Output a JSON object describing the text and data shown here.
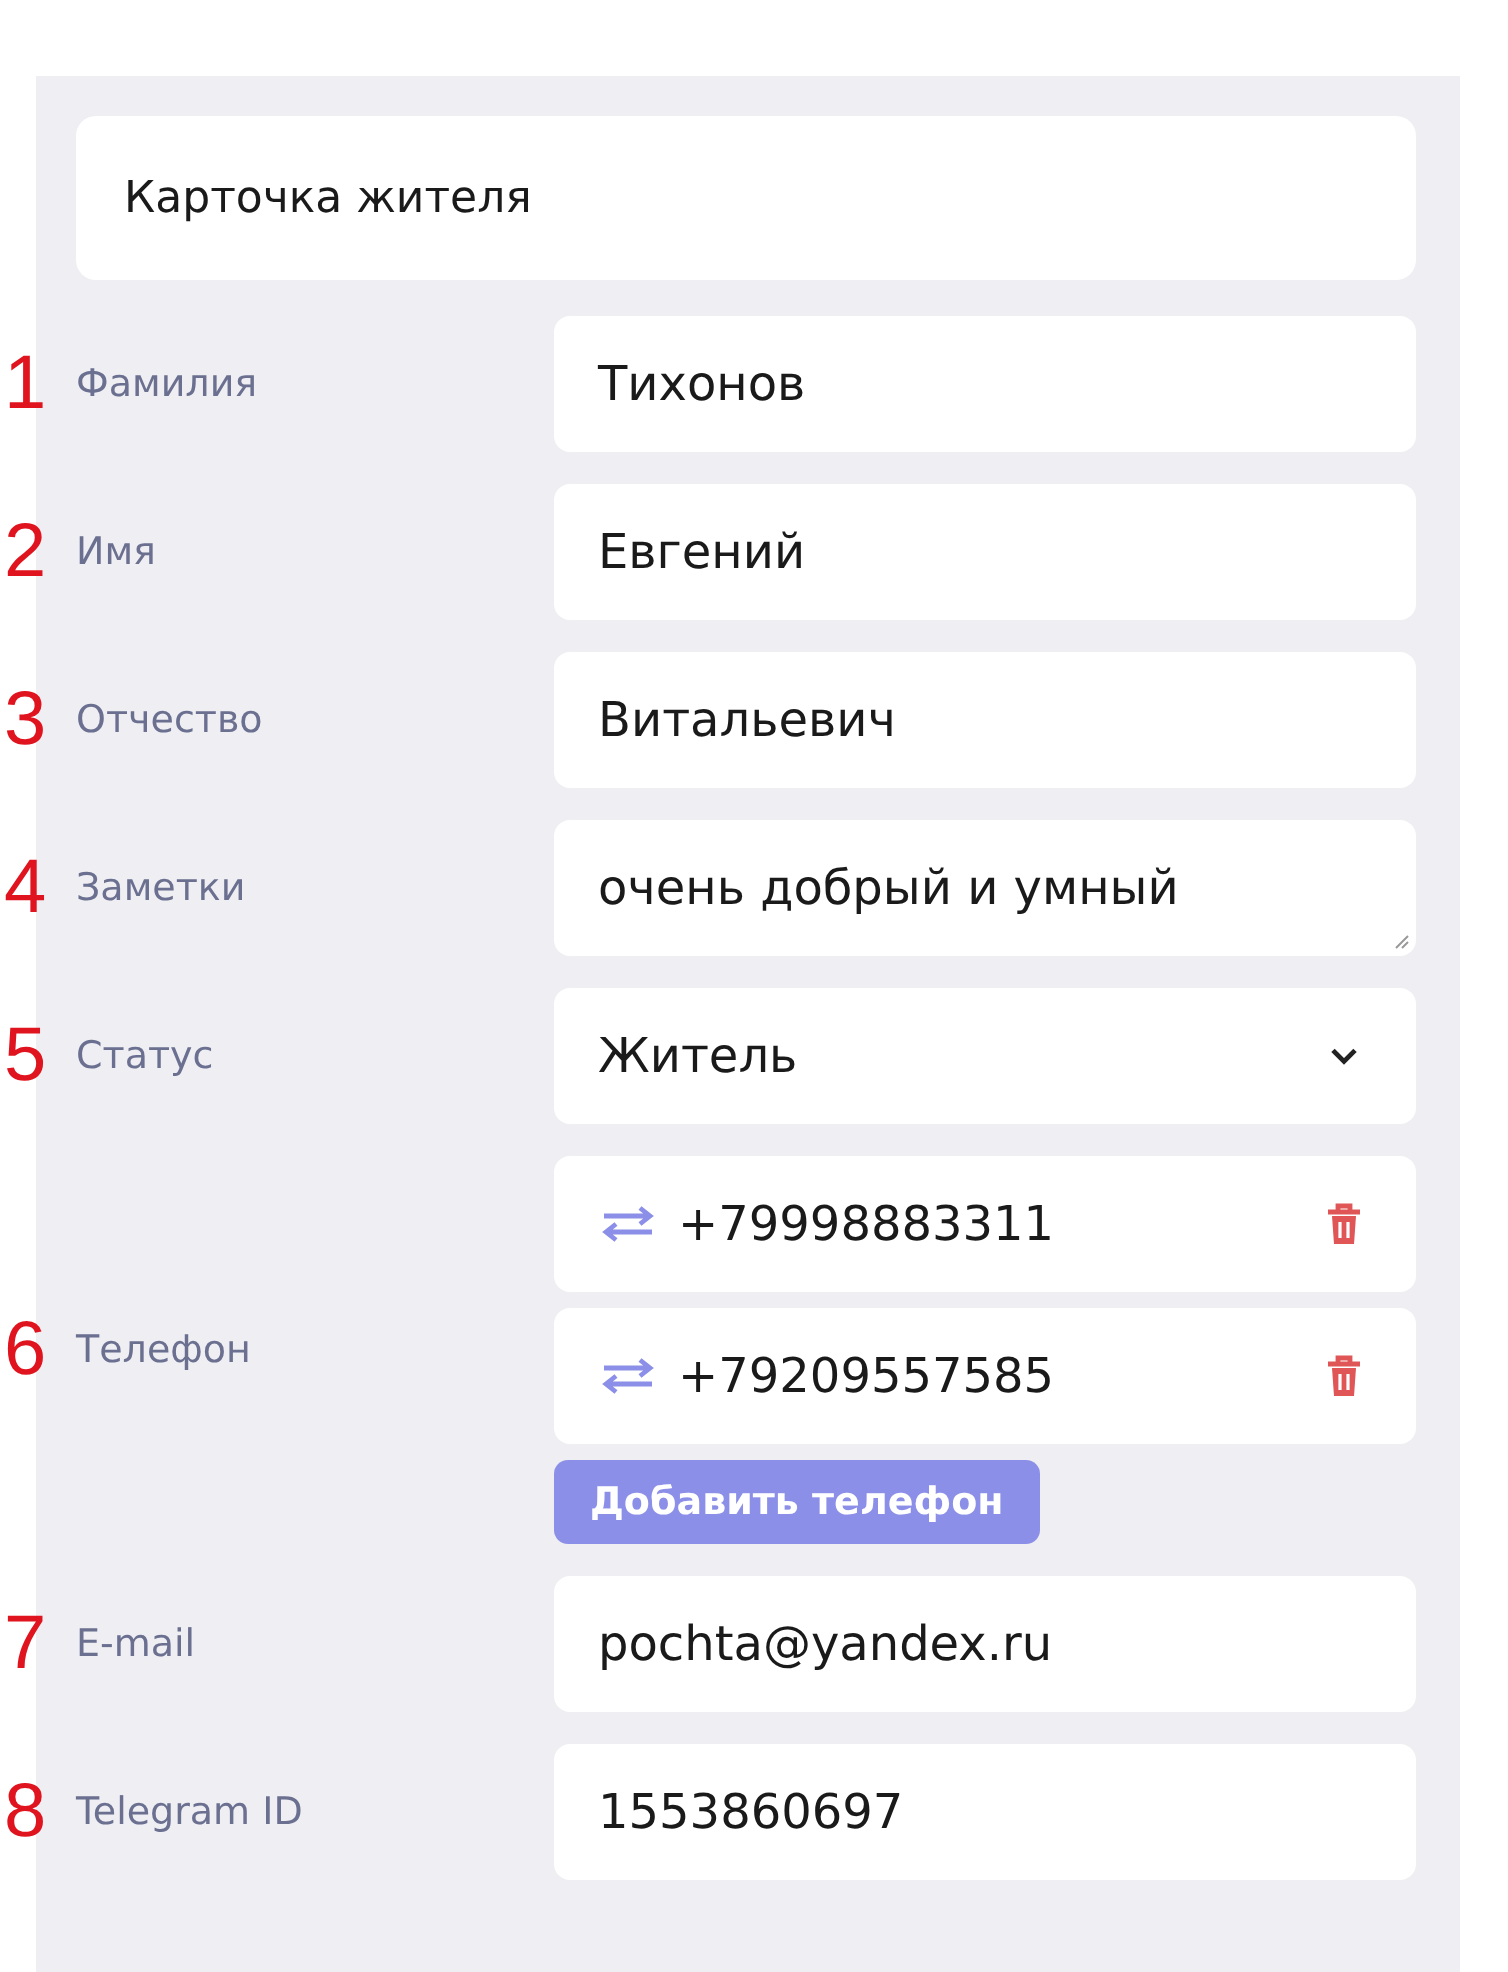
{
  "title": "Карточка жителя",
  "fields": [
    {
      "marker": "1",
      "label": "Фамилия",
      "kind": "text",
      "value": "Тихонов"
    },
    {
      "marker": "2",
      "label": "Имя",
      "kind": "text",
      "value": "Евгений"
    },
    {
      "marker": "3",
      "label": "Отчество",
      "kind": "text",
      "value": "Витальевич"
    },
    {
      "marker": "4",
      "label": "Заметки",
      "kind": "textarea",
      "value": "очень добрый и умный"
    },
    {
      "marker": "5",
      "label": "Статус",
      "kind": "select",
      "value": "Житель"
    },
    {
      "marker": "6",
      "label": "Телефон",
      "kind": "phones",
      "phones": [
        "+79998883311",
        "+79209557585"
      ],
      "add_button": "Добавить телефон"
    },
    {
      "marker": "7",
      "label": "E-mail",
      "kind": "text",
      "value": "pochta@yandex.ru"
    },
    {
      "marker": "8",
      "label": "Telegram ID",
      "kind": "text",
      "value": "1553860697"
    }
  ]
}
